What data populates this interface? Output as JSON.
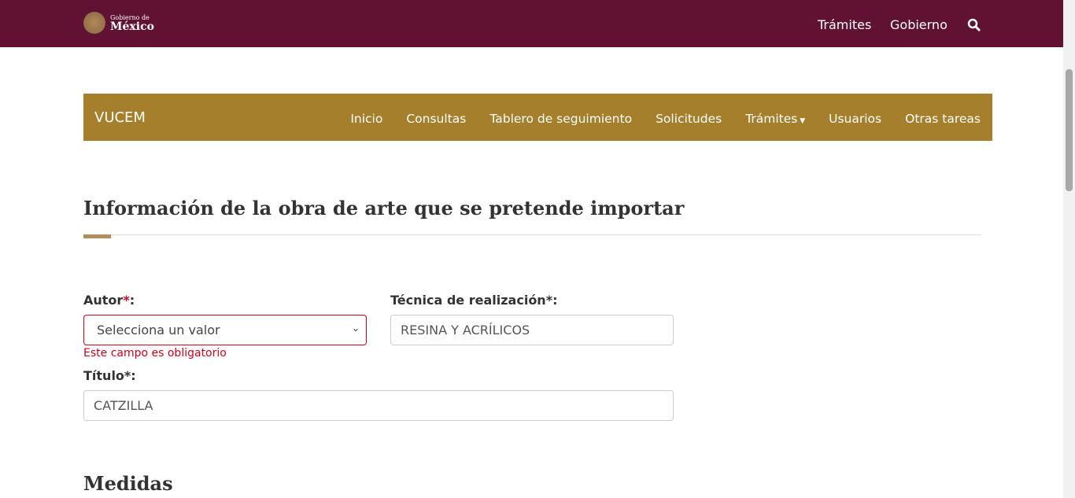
{
  "header": {
    "logo_line1": "Gobierno de",
    "logo_line2": "México",
    "nav": [
      "Trámites",
      "Gobierno"
    ],
    "search_icon": "search-icon",
    "bg": "#611232"
  },
  "navbar": {
    "brand": "VUCEM",
    "items": [
      "Inicio",
      "Consultas",
      "Tablero de seguimiento",
      "Solicitudes",
      "Trámites",
      "Usuarios",
      "Otras tareas"
    ],
    "bg": "#a57f2c"
  },
  "section": {
    "title": "Información de la obra de arte que se pretende importar"
  },
  "form": {
    "autor_label": "Autor",
    "autor_value": "Selecciona un valor",
    "autor_error": "Este campo es obligatorio",
    "tecnica_label": "Técnica de realización*:",
    "tecnica_value": "RESINA Y ACRÍLICOS",
    "titulo_label": "Título*:",
    "titulo_value": "CATZILLA"
  },
  "medidas": {
    "title": "Medidas"
  }
}
